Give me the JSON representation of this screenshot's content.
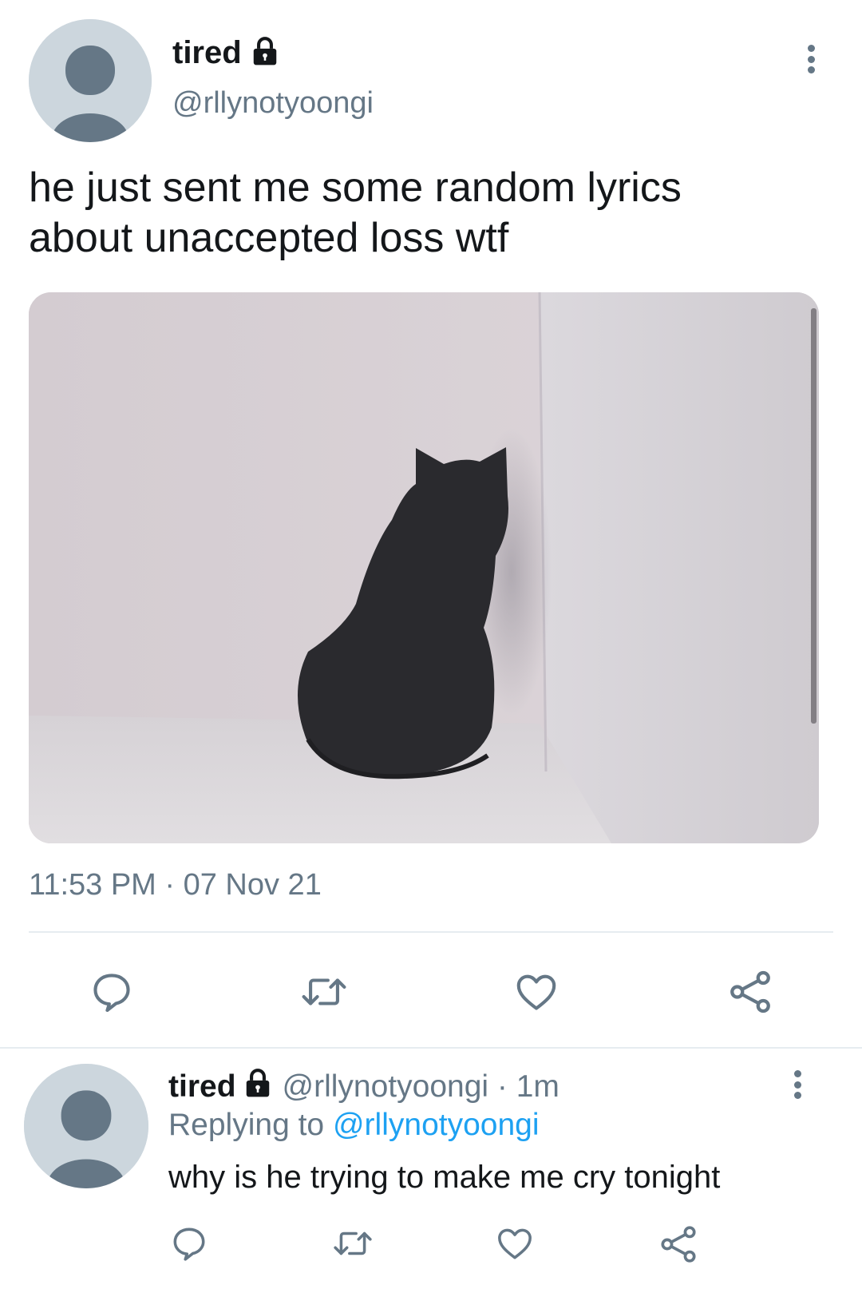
{
  "main_tweet": {
    "display_name": "tired",
    "handle": "@rllynotyoongi",
    "text_line1": "he just sent me some random lyrics",
    "text_line2": "about unaccepted loss wtf",
    "timestamp": "11:53 PM · 07 Nov 21",
    "media_subject": "black cat sitting facing a wall corner"
  },
  "reply_tweet": {
    "display_name": "tired",
    "handle_time": "@rllynotyoongi · 1m",
    "replying_prefix": "Replying to",
    "replying_handle": "@rllynotyoongi",
    "text": "why is he trying to make me cry tonight"
  },
  "icons": {
    "reply": "reply-bubble-icon",
    "retweet": "retweet-icon",
    "like": "heart-icon",
    "share": "share-icon",
    "lock": "lock-icon",
    "more": "more-vertical-icon"
  },
  "colors": {
    "text": "#14171a",
    "muted": "#657786",
    "link": "#1da1f2",
    "avatar_bg": "#ccd6dd",
    "avatar_fg": "#657786"
  }
}
